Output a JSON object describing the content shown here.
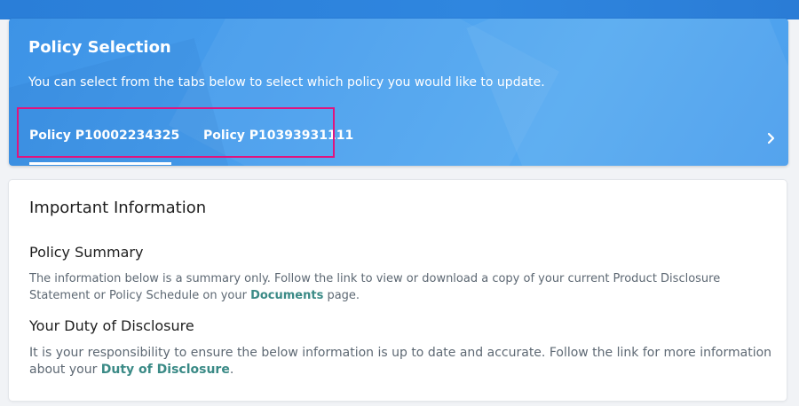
{
  "policy_selection": {
    "title": "Policy Selection",
    "description": "You can select from the tabs below to select which policy you would like to update.",
    "tabs": [
      {
        "label": "Policy P10002234325",
        "selected": true
      },
      {
        "label": "Policy P10393931111",
        "selected": false
      }
    ],
    "next_icon": "chevron-right-icon"
  },
  "important_info": {
    "title": "Important Information",
    "policy_summary": {
      "heading": "Policy Summary",
      "text_before": "The information below is a summary only. Follow the link to view or download a copy of your current Product Disclosure Statement or Policy Schedule on your ",
      "link_label": "Documents",
      "text_after": " page."
    },
    "duty_of_disclosure": {
      "heading": "Your Duty of Disclosure",
      "text_before": "It is your responsibility to ensure the below information is up to date and accurate. Follow the link for more information about your ",
      "link_label": "Duty of Disclosure",
      "text_after": "."
    }
  },
  "colors": {
    "accent_blue": "#4aa0ee",
    "highlight_border": "#e0147e",
    "link_teal": "#3a8a86"
  }
}
